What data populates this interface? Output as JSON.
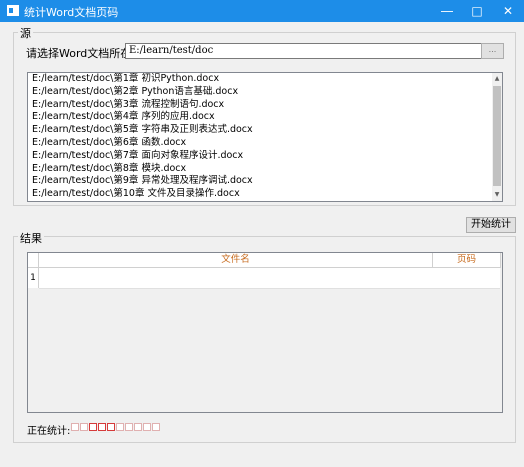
{
  "window": {
    "title": "统计Word文档页码"
  },
  "source": {
    "group_title": "源",
    "dir_label": "请选择Word文档所在目录:",
    "dir_value": "E:/learn/test/doc",
    "browse_label": "...",
    "files": [
      "E:/learn/test/doc\\第1章  初识Python.docx",
      "E:/learn/test/doc\\第2章  Python语言基础.docx",
      "E:/learn/test/doc\\第3章  流程控制语句.docx",
      "E:/learn/test/doc\\第4章  序列的应用.docx",
      "E:/learn/test/doc\\第5章  字符串及正则表达式.docx",
      "E:/learn/test/doc\\第6章  函数.docx",
      "E:/learn/test/doc\\第7章  面向对象程序设计.docx",
      "E:/learn/test/doc\\第8章  模块.docx",
      "E:/learn/test/doc\\第9章  异常处理及程序调试.docx",
      "E:/learn/test/doc\\第10章  文件及目录操作.docx"
    ]
  },
  "start_button": "开始统计",
  "result": {
    "group_title": "结果",
    "columns": [
      "文件名",
      "页码"
    ],
    "row_numbers": [
      "1"
    ]
  },
  "status": {
    "label": "正在统计:",
    "progress_total_blocks": 10,
    "progress_filled_blocks": 3
  },
  "colors": {
    "titlebar": "#1d8de8",
    "header_text": "#c76b1e",
    "progress": "#d63a3a"
  }
}
